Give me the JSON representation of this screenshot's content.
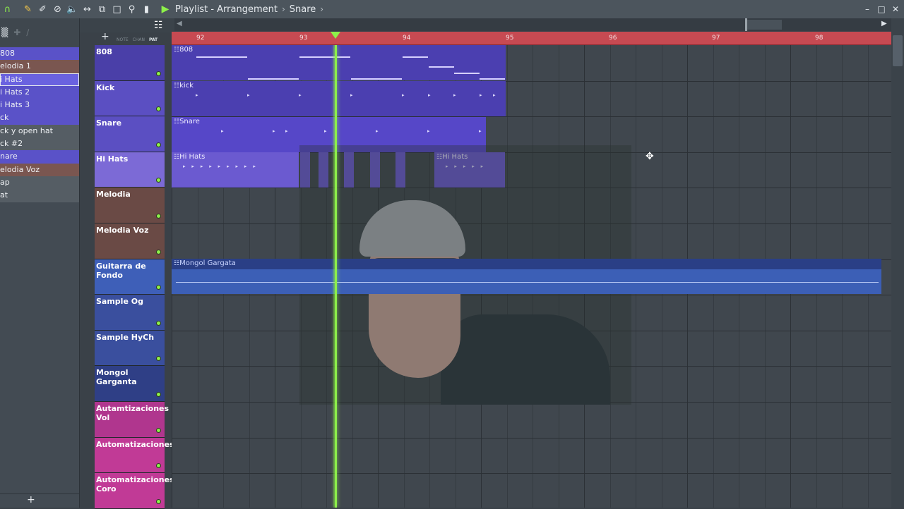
{
  "titlebar": {
    "breadcrumb": [
      "Playlist - Arrangement",
      "Snare"
    ],
    "tools": [
      "magnet-icon",
      "pencil-icon",
      "paint-icon",
      "delete-icon",
      "mute-icon",
      "slip-icon",
      "select-icon",
      "slice-icon",
      "zoom-icon",
      "playback-icon"
    ],
    "window": {
      "minimize": "–",
      "maximize": "□",
      "close": "✕"
    }
  },
  "picker": {
    "items": [
      {
        "label": "808",
        "color": "blue"
      },
      {
        "label": "elodia 1",
        "color": "brown"
      },
      {
        "label": "i Hats",
        "color": "blue",
        "selected": true
      },
      {
        "label": "i Hats 2",
        "color": "blue"
      },
      {
        "label": "i Hats 3",
        "color": "blue"
      },
      {
        "label": "ck",
        "color": "blue"
      },
      {
        "label": "ck y open hat",
        "color": "grey"
      },
      {
        "label": "ck #2",
        "color": "grey"
      },
      {
        "label": "nare",
        "color": "blue"
      },
      {
        "label": "elodia Voz",
        "color": "brown"
      },
      {
        "label": "ap",
        "color": "grey"
      },
      {
        "label": "at",
        "color": "grey"
      }
    ],
    "add": "+"
  },
  "playlist": {
    "add": "+",
    "modes": [
      "NOTE",
      "CHAN",
      "PAT"
    ],
    "ruler": [
      {
        "bar": "92"
      },
      {
        "bar": "93"
      },
      {
        "bar": "94"
      },
      {
        "bar": "95"
      },
      {
        "bar": "96"
      },
      {
        "bar": "97"
      },
      {
        "bar": "98"
      }
    ],
    "tracks": [
      {
        "name": "808",
        "style": "t-purple"
      },
      {
        "name": "Kick",
        "style": "t-violet"
      },
      {
        "name": "Snare",
        "style": "t-violet"
      },
      {
        "name": "Hi Hats",
        "style": "t-hihat"
      },
      {
        "name": "Melodia",
        "style": "t-brown"
      },
      {
        "name": "Melodia Voz",
        "style": "t-brown"
      },
      {
        "name": "Guitarra de Fondo",
        "style": "t-blue"
      },
      {
        "name": "Sample Og",
        "style": "t-blue2"
      },
      {
        "name": "Sample HyCh",
        "style": "t-blue2"
      },
      {
        "name": "Mongol Garganta",
        "style": "t-navy"
      },
      {
        "name": "Autamtizaciones Vol",
        "style": "t-magenta"
      },
      {
        "name": "Automatizaciones",
        "style": "t-magenta2"
      },
      {
        "name": "Automatizaciones Coro",
        "style": "t-magenta2"
      }
    ],
    "clips": {
      "c808": "808",
      "kick": "kick",
      "snare": "Snare",
      "hihats1": "Hi Hats",
      "hihats2": "Hi Hats",
      "guitar": "Mongol Gargata"
    },
    "colors": {
      "ruler": "#c74a52",
      "playhead": "#8df04a",
      "clip_purple": "#4b3fb0",
      "clip_hihat": "#6b5ad0",
      "clip_audio": "#3c5fb6"
    }
  }
}
